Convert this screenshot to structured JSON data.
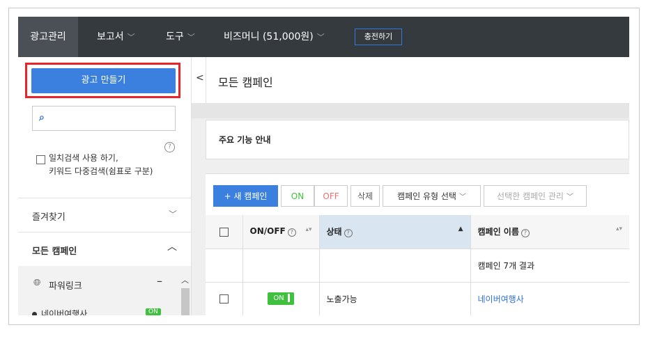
{
  "topnav": {
    "items": [
      "광고관리",
      "보고서",
      "도구",
      "비즈머니 (51,000원)"
    ],
    "charge_label": "충전하기"
  },
  "sidebar": {
    "create_ad_label": "광고 만들기",
    "search_placeholder": "",
    "help_glyph": "?",
    "exact_search_line1": "일치검색 사용 하기,",
    "exact_search_line2": "키워드 다중검색(쉼표로 구분)",
    "favorites_label": "즐겨찾기",
    "all_campaigns_label": "모든 캠페인",
    "powerlink_label": "파워링크",
    "powerlink_minus": "–",
    "sub_item_label": "네이버여행사",
    "sub_item_status": "ON"
  },
  "main": {
    "collapse_glyph": "<",
    "title": "모든 캠페인",
    "guide_title": "주요 기능 안내",
    "toolbar": {
      "new_campaign": "+ 새 캠페인",
      "on": "ON",
      "off": "OFF",
      "delete": "삭제",
      "campaign_type": "캠페인 유형 선택",
      "manage_selected": "선택한 캠페인 관리"
    },
    "table": {
      "headers": {
        "onoff": "ON/OFF",
        "state": "상태",
        "name": "캠페인 이름",
        "help": "?"
      },
      "results_text": "캠페인 7개 결과",
      "rows": [
        {
          "toggle": "ON",
          "state": "노출가능",
          "name": "네이버여행사"
        }
      ]
    }
  },
  "colors": {
    "nav_bg": "#353a3f",
    "accent": "#3b80df",
    "on_green": "#3fc03f",
    "highlight_red": "#e8232a"
  }
}
